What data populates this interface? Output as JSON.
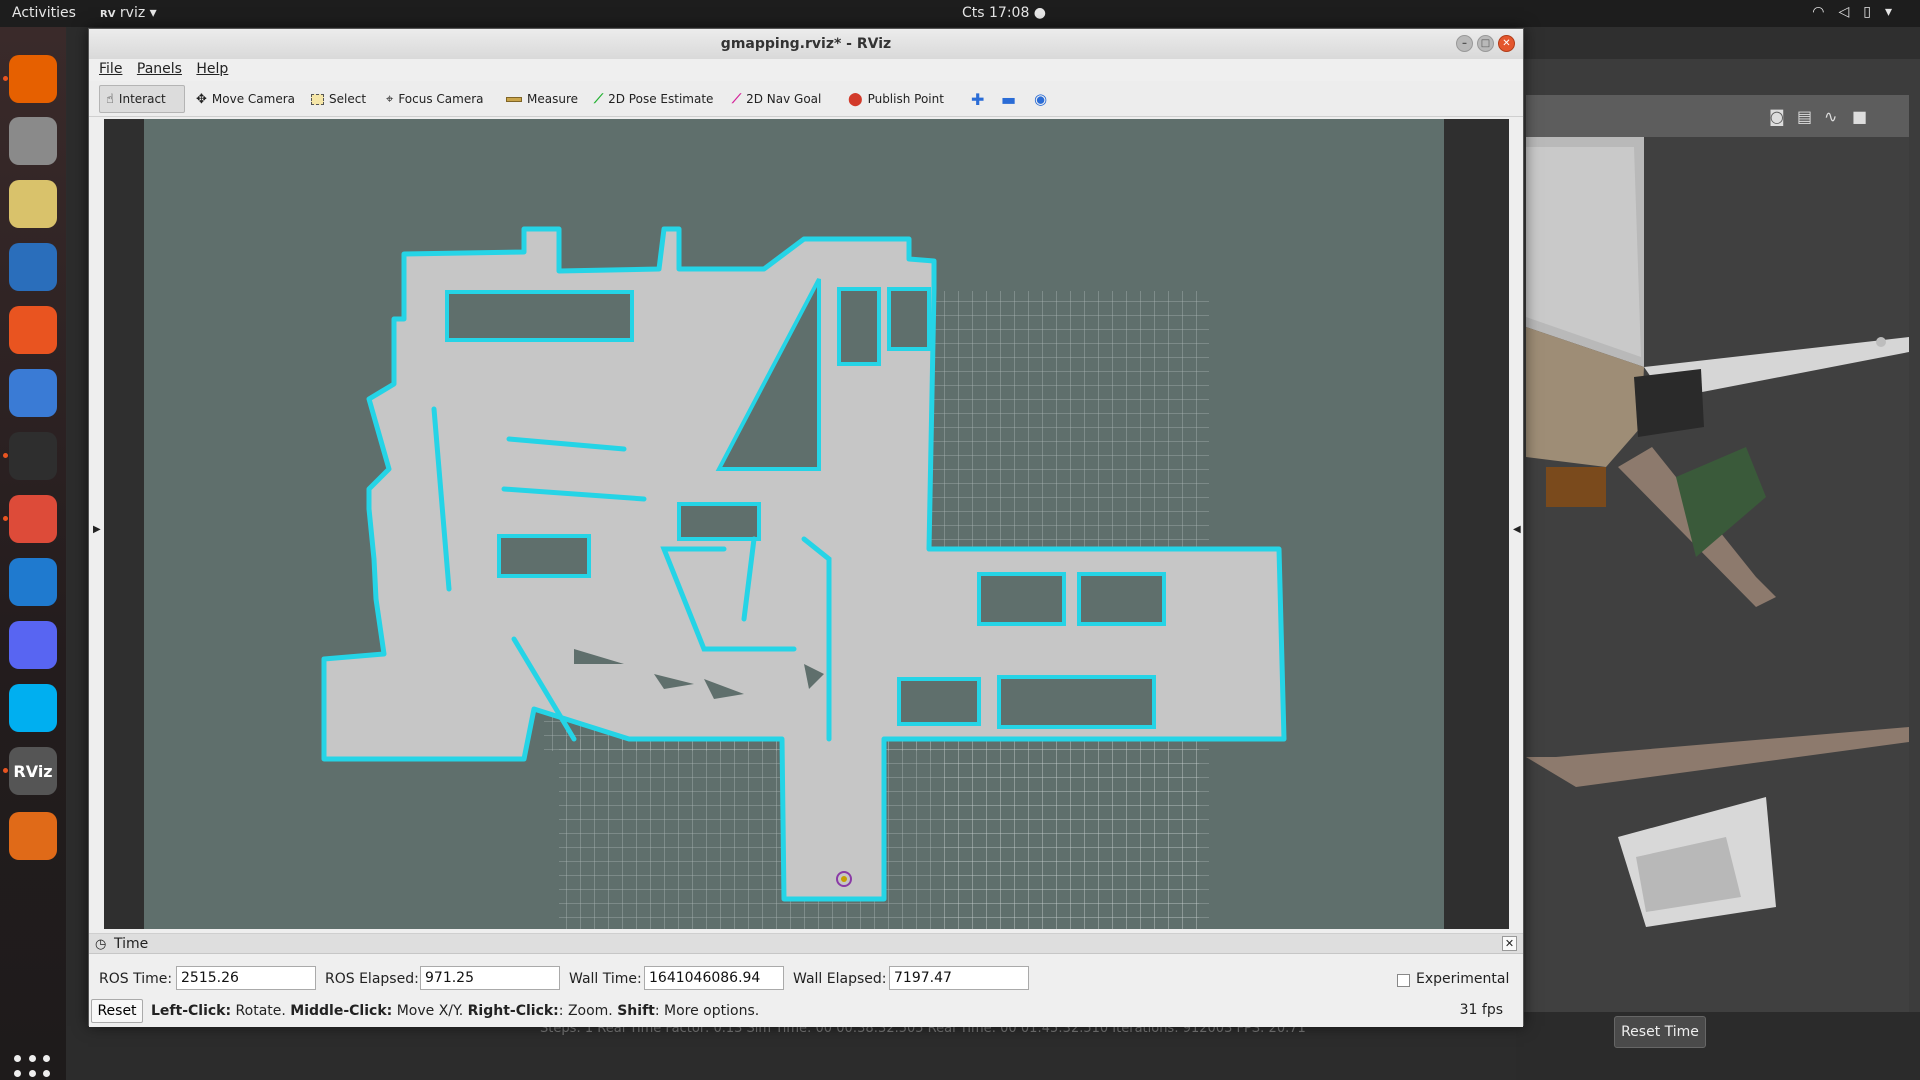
{
  "topbar": {
    "activities": "Activities",
    "app_name": "rviz",
    "clock": "Cts 17:08 ●"
  },
  "dock": {
    "items": [
      {
        "name": "firefox-icon",
        "color": "#e66000"
      },
      {
        "name": "files-icon",
        "color": "#8a8a8a"
      },
      {
        "name": "rhythmbox-icon",
        "color": "#d9c26b"
      },
      {
        "name": "writer-icon",
        "color": "#2a6ebb"
      },
      {
        "name": "software-icon",
        "color": "#e95420"
      },
      {
        "name": "help-icon",
        "color": "#3a7bd5"
      },
      {
        "name": "terminal-icon",
        "color": "#2e2e2e"
      },
      {
        "name": "chrome-icon",
        "color": "#dd4b39"
      },
      {
        "name": "vscode-icon",
        "color": "#1f7acf"
      },
      {
        "name": "discord-icon",
        "color": "#5865f2"
      },
      {
        "name": "skype-icon",
        "color": "#00aff0"
      },
      {
        "name": "rviz-icon",
        "color": "#555555"
      },
      {
        "name": "gazebo-icon",
        "color": "#e06a18"
      }
    ],
    "rviz_label": "RViz"
  },
  "gazebo": {
    "reset_time": "Reset Time",
    "status": "Steps: 1   Real Time Factor: 0.13   Sim Time: 00 00:38:32.505   Real Time: 00 01:45:32.510   Iterations: 912003   FPS: 20.71"
  },
  "rviz": {
    "title": "gmapping.rviz* - RViz",
    "menu": [
      "File",
      "Panels",
      "Help"
    ],
    "tools": [
      {
        "label": "Interact",
        "icon": "hand-icon"
      },
      {
        "label": "Move Camera",
        "icon": "move-icon"
      },
      {
        "label": "Select",
        "icon": "select-icon"
      },
      {
        "label": "Focus Camera",
        "icon": "focus-icon"
      },
      {
        "label": "Measure",
        "icon": "ruler-icon"
      },
      {
        "label": "2D Pose Estimate",
        "icon": "green-arrow-icon"
      },
      {
        "label": "2D Nav Goal",
        "icon": "pink-arrow-icon"
      },
      {
        "label": "Publish Point",
        "icon": "pin-icon"
      }
    ],
    "time_panel": {
      "title": "Time",
      "ros_time_label": "ROS Time:",
      "ros_time": "2515.26",
      "ros_elapsed_label": "ROS Elapsed:",
      "ros_elapsed": "971.25",
      "wall_time_label": "Wall Time:",
      "wall_time": "1641046086.94",
      "wall_elapsed_label": "Wall Elapsed:",
      "wall_elapsed": "7197.47",
      "experimental": "Experimental",
      "reset": "Reset",
      "hint_parts": [
        "Left-Click:",
        " Rotate. ",
        "Middle-Click:",
        " Move X/Y. ",
        "Right-Click:",
        ": Zoom. ",
        "Shift",
        ": More options."
      ],
      "fps": "31 fps"
    }
  },
  "colors": {
    "map_bg": "#5f6f6c",
    "free_space": "#c4c4c4",
    "wall": "#25d4e6",
    "grid": "#cfd6d6"
  }
}
